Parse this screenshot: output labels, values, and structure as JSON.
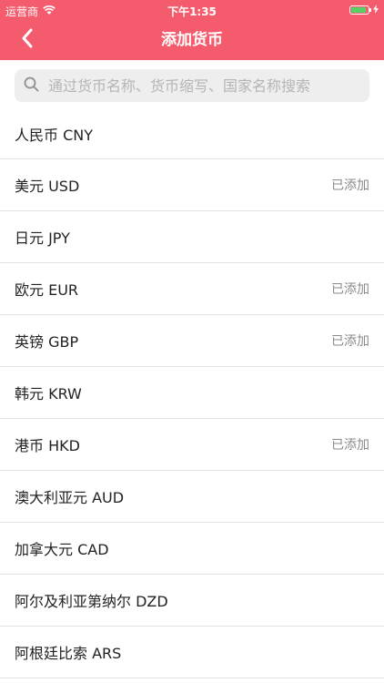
{
  "status_bar": {
    "carrier": "运营商",
    "time": "下午1:35",
    "battery_level": 0.9,
    "battery_color": "#57d163"
  },
  "header": {
    "title": "添加货币",
    "back_icon": "chevron-left-icon",
    "background": "#f45c6e"
  },
  "search": {
    "icon": "search-icon",
    "placeholder": "通过货币名称、货币缩写、国家名称搜索",
    "value": ""
  },
  "currencies": [
    {
      "name": "人民币 CNY",
      "status": ""
    },
    {
      "name": "美元 USD",
      "status": "已添加"
    },
    {
      "name": "日元 JPY",
      "status": ""
    },
    {
      "name": "欧元 EUR",
      "status": "已添加"
    },
    {
      "name": "英镑 GBP",
      "status": "已添加"
    },
    {
      "name": "韩元 KRW",
      "status": ""
    },
    {
      "name": "港币 HKD",
      "status": "已添加"
    },
    {
      "name": "澳大利亚元 AUD",
      "status": ""
    },
    {
      "name": "加拿大元 CAD",
      "status": ""
    },
    {
      "name": "阿尔及利亚第纳尔 DZD",
      "status": ""
    },
    {
      "name": "阿根廷比索 ARS",
      "status": ""
    }
  ]
}
